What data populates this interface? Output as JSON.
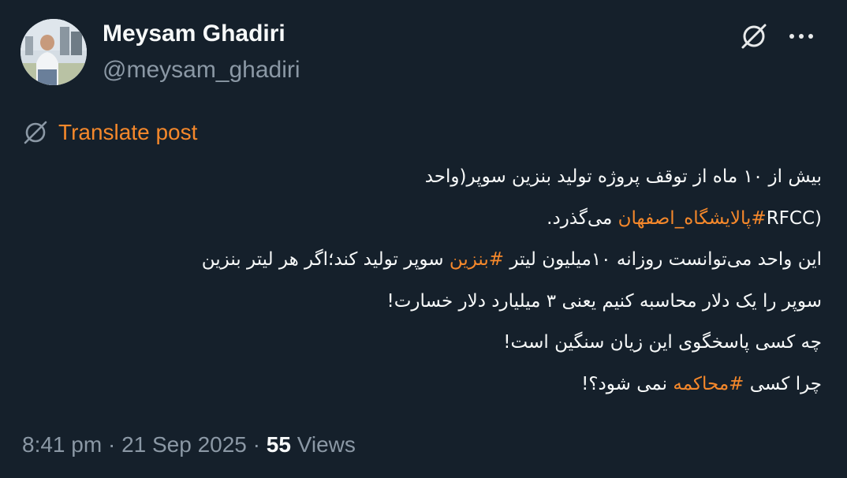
{
  "author": {
    "display_name": "Meysam Ghadiri",
    "handle": "@meysam_ghadiri",
    "avatar_icon": "profile-photo"
  },
  "header_icons": {
    "grok": "grok-icon",
    "more": "more-icon",
    "more_glyph": "···"
  },
  "translate": {
    "label": "Translate post",
    "icon": "translate-icon"
  },
  "tweet": {
    "line1": "بیش از ۱۰ ماه از توقف پروژه تولید بنزین سوپر(واحد",
    "line2_pre": "RFCC)",
    "line2_tag": "#پالایشگاه_اصفهان",
    "line2_post": " می‌گذرد.",
    "line3_pre": "این واحد می‌توانست روزانه ۱۰میلیون لیتر ",
    "line3_tag": "#بنزین",
    "line3_post": " سوپر تولید کند؛اگر هر لیتر بنزین",
    "line4": "سوپر را یک دلار محاسبه کنیم یعنی ۳ میلیارد دلار خسارت!",
    "line5": "چه کسی پاسخگوی این زیان سنگین است!",
    "line6_pre": "چرا کسی ",
    "line6_tag": "#محاکمه",
    "line6_post": " نمی شود؟!"
  },
  "meta": {
    "time": "8:41 pm",
    "sep1": " · ",
    "date": "21 Sep 2025",
    "sep2": " · ",
    "views_count": "55",
    "views_label": " Views"
  },
  "colors": {
    "background": "#15202b",
    "text": "#f7f9f9",
    "secondary": "#8b98a5",
    "accent": "#f5882b"
  }
}
